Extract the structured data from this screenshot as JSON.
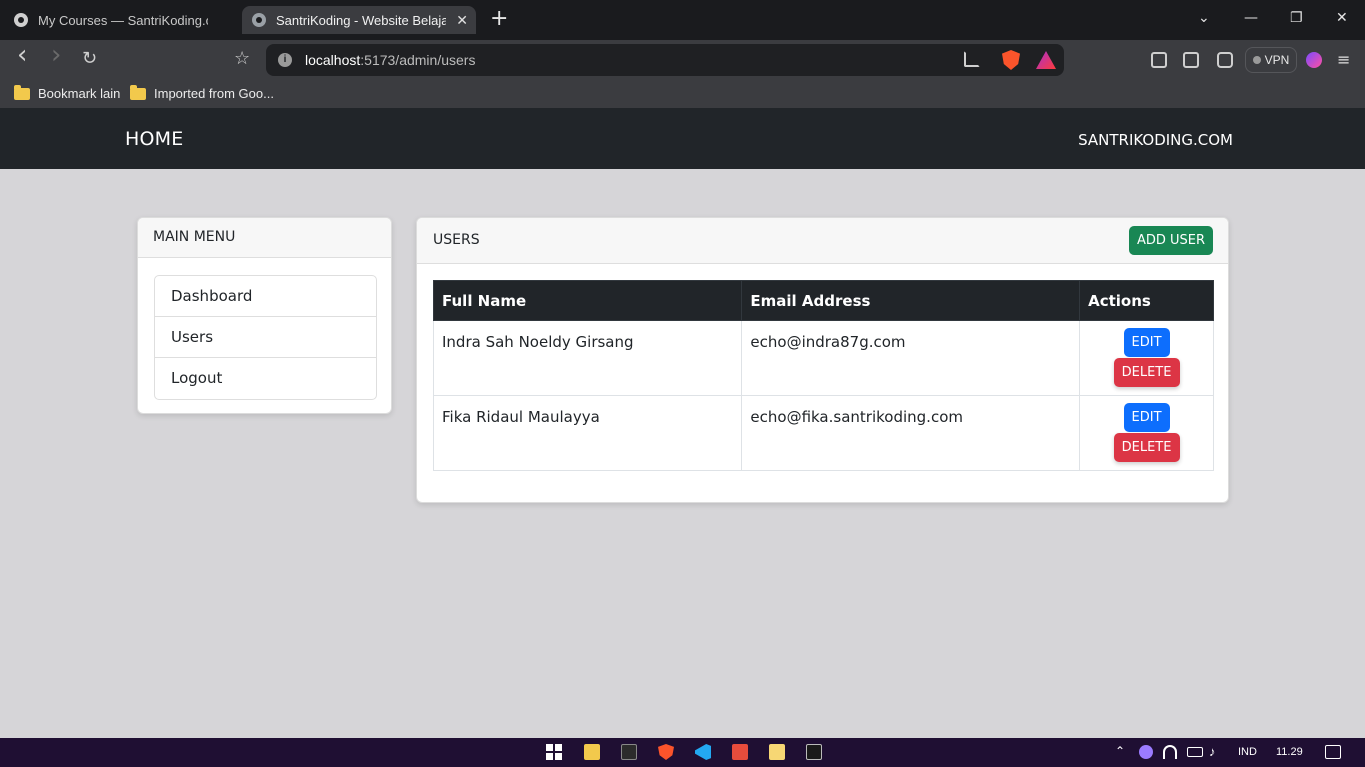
{
  "browser": {
    "tabs": [
      {
        "title": "My Courses — SantriKoding.com —"
      },
      {
        "title": "SantriKoding - Website Belajar C",
        "close": "✕"
      }
    ],
    "new_tab": "+",
    "window_controls": {
      "dropdown": "⌄",
      "minimize": "—",
      "restore": "❐",
      "close": "✕"
    },
    "nav": {
      "back": "‹",
      "forward": "›",
      "reload": "↻",
      "bookmark": "☆"
    },
    "url": {
      "host": "localhost",
      "rest": ":5173/admin/users"
    },
    "vpn_label": "VPN",
    "menu": "≡",
    "bookmarks": [
      {
        "label": "Bookmark lain"
      },
      {
        "label": "Imported from Goo..."
      }
    ]
  },
  "navbar": {
    "brand": "HOME",
    "right_text": "SANTRIKODING.COM"
  },
  "sidebar": {
    "title": "MAIN MENU",
    "items": [
      {
        "label": "Dashboard"
      },
      {
        "label": "Users"
      },
      {
        "label": "Logout"
      }
    ]
  },
  "users": {
    "title": "USERS",
    "add_button": "ADD USER",
    "columns": [
      "Full Name",
      "Email Address",
      "Actions"
    ],
    "rows": [
      {
        "name": "Indra Sah Noeldy Girsang",
        "email": "echo@indra87g.com",
        "edit": "EDIT",
        "delete": "DELETE"
      },
      {
        "name": "Fika Ridaul Maulayya",
        "email": "echo@fika.santrikoding.com",
        "edit": "EDIT",
        "delete": "DELETE"
      }
    ]
  },
  "taskbar": {
    "language": "IND",
    "time": "11.29"
  },
  "colors": {
    "navbar_bg": "#212529",
    "page_bg": "#d6d5d8",
    "add_button": "#198754",
    "edit_button": "#0d6efd",
    "delete_button": "#dc3545"
  }
}
